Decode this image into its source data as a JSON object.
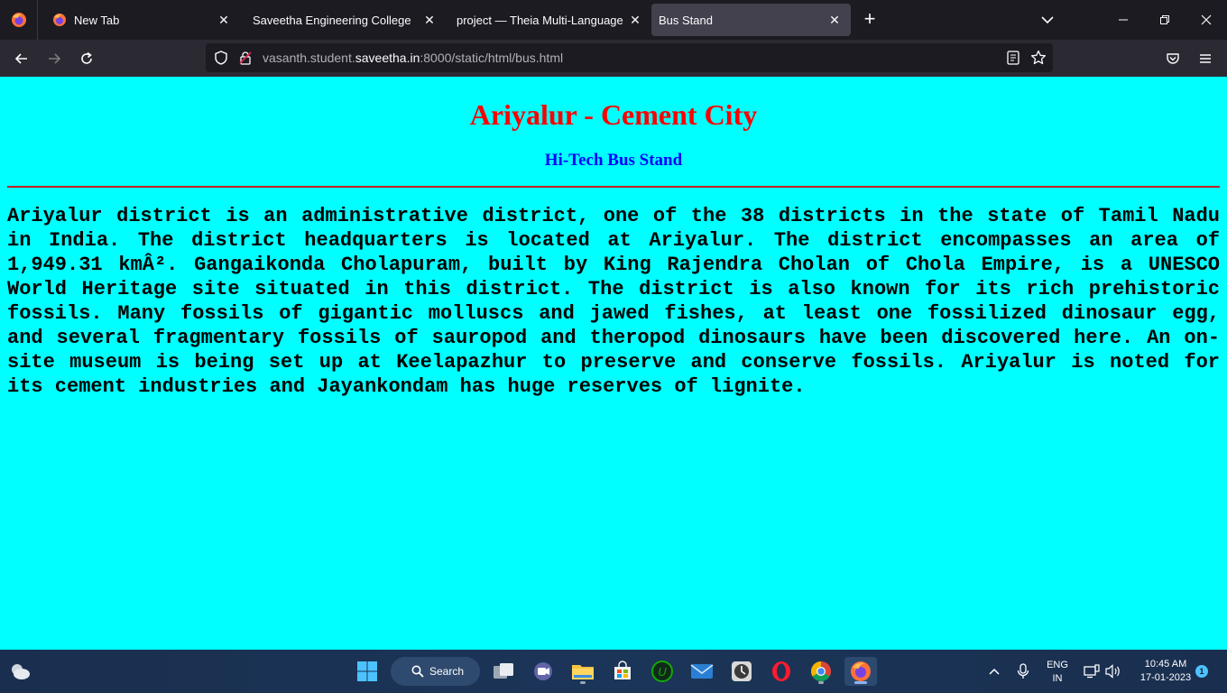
{
  "browser": {
    "tabs": [
      {
        "title": "New Tab",
        "active": false
      },
      {
        "title": "Saveetha Engineering College",
        "active": false
      },
      {
        "title": "project — Theia Multi-Language Ex",
        "active": false
      },
      {
        "title": "Bus Stand",
        "active": true
      }
    ],
    "url_prefix": "vasanth.student.",
    "url_domain": "saveetha.in",
    "url_suffix": ":8000/static/html/bus.html"
  },
  "page": {
    "heading": "Ariyalur - Cement City",
    "subheading": "Hi-Tech Bus Stand",
    "paragraph": "Ariyalur district is an administrative district, one of the 38 districts in the state of Tamil Nadu in India. The district headquarters is located at Ariyalur. The district encompasses an area of 1,949.31 kmÂ². Gangaikonda Cholapuram, built by King Rajendra Cholan of Chola Empire, is a UNESCO World Heritage site situated in this district. The district is also known for its rich prehistoric fossils. Many fossils of gigantic molluscs and jawed fishes, at least one fossilized dinosaur egg, and several fragmentary fossils of sauropod and theropod dinosaurs have been discovered here. An on-site museum is being set up at Keelapazhur to preserve and conserve fossils. Ariyalur is noted for its cement industries and Jayankondam has huge reserves of lignite.",
    "background_color": "#00ffff",
    "heading_color": "#ff0000",
    "subheading_color": "#0000ff"
  },
  "taskbar": {
    "search_label": "Search",
    "language_line1": "ENG",
    "language_line2": "IN",
    "time": "10:45 AM",
    "date": "17-01-2023",
    "notification_count": "1"
  }
}
